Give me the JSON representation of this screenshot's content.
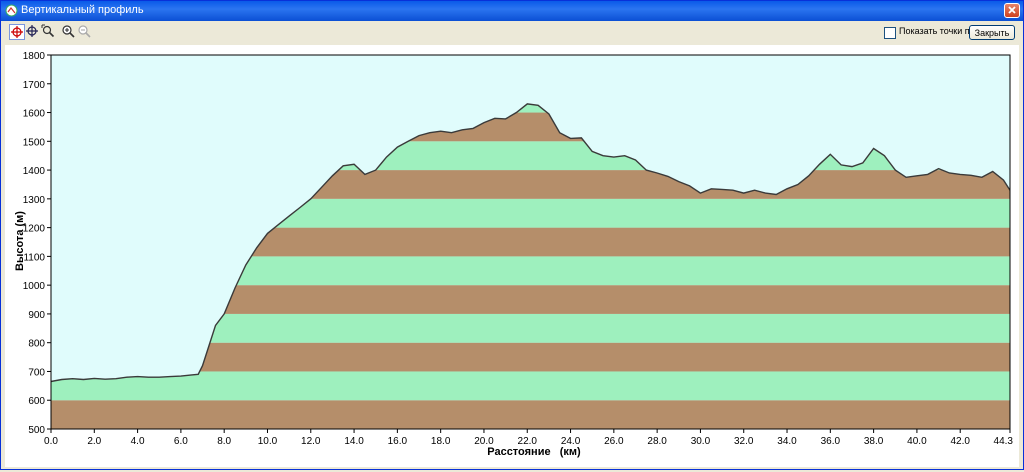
{
  "window": {
    "title": "Вертикальный профиль"
  },
  "toolbar": {
    "tools": [
      {
        "name": "select-point-tool",
        "icon": "crosshair-red-icon",
        "active": true
      },
      {
        "name": "move-tool",
        "icon": "crosshair-blue-icon",
        "active": false
      },
      {
        "name": "zoom-area-tool",
        "icon": "zoom-area-icon",
        "active": false
      },
      {
        "name": "zoom-in-tool",
        "icon": "zoom-in-icon",
        "active": false
      },
      {
        "name": "zoom-out-tool",
        "icon": "zoom-out-icon",
        "active": false
      }
    ],
    "show_waypoints_label": "Показать точки пути",
    "show_waypoints_checked": false,
    "close_label": "Закрыть"
  },
  "colors": {
    "plot_background": "#e0fcfc",
    "band_green": "#9ef0be",
    "band_brown": "#b58e6a",
    "profile_line": "#3a3a3a"
  },
  "chart_data": {
    "type": "area",
    "xlabel": "Расстояние   (км)",
    "ylabel": "Высота (м)",
    "xlim": [
      0,
      44.3
    ],
    "ylim": [
      500,
      1800
    ],
    "x_ticks": [
      "0.0",
      "2.0",
      "4.0",
      "6.0",
      "8.0",
      "10.0",
      "12.0",
      "14.0",
      "16.0",
      "18.0",
      "20.0",
      "22.0",
      "24.0",
      "26.0",
      "28.0",
      "30.0",
      "32.0",
      "34.0",
      "36.0",
      "38.0",
      "40.0",
      "42.0",
      "44.3"
    ],
    "y_ticks": [
      "500",
      "600",
      "700",
      "800",
      "900",
      "1000",
      "1100",
      "1200",
      "1300",
      "1400",
      "1500",
      "1600",
      "1700",
      "1800"
    ],
    "grid": false,
    "series": [
      {
        "x": [
          0,
          0.5,
          1,
          1.5,
          2,
          2.5,
          3,
          3.5,
          4,
          4.5,
          5,
          5.5,
          6,
          6.5,
          6.8,
          7,
          7.3,
          7.6,
          8,
          8.5,
          9,
          9.5,
          10,
          10.5,
          11,
          11.5,
          12,
          12.5,
          13,
          13.5,
          14,
          14.5,
          15,
          15.5,
          16,
          16.5,
          17,
          17.5,
          18,
          18.5,
          19,
          19.5,
          20,
          20.5,
          21,
          21.5,
          22,
          22.5,
          23,
          23.5,
          24,
          24.5,
          25,
          25.5,
          26,
          26.5,
          27,
          27.5,
          28,
          28.5,
          29,
          29.5,
          30,
          30.5,
          31,
          31.5,
          32,
          32.5,
          33,
          33.5,
          34,
          34.5,
          35,
          35.5,
          36,
          36.5,
          37,
          37.5,
          38,
          38.5,
          39,
          39.5,
          40,
          40.5,
          41,
          41.5,
          42,
          42.5,
          43,
          43.5,
          44,
          44.3
        ],
        "y": [
          665,
          672,
          675,
          672,
          676,
          673,
          675,
          680,
          682,
          680,
          680,
          682,
          684,
          688,
          690,
          720,
          790,
          860,
          900,
          990,
          1070,
          1130,
          1180,
          1210,
          1240,
          1270,
          1300,
          1340,
          1380,
          1415,
          1420,
          1385,
          1400,
          1445,
          1480,
          1500,
          1520,
          1530,
          1535,
          1530,
          1540,
          1545,
          1565,
          1580,
          1578,
          1600,
          1630,
          1625,
          1595,
          1530,
          1510,
          1512,
          1465,
          1450,
          1445,
          1450,
          1435,
          1400,
          1390,
          1378,
          1360,
          1345,
          1320,
          1335,
          1333,
          1330,
          1320,
          1330,
          1320,
          1315,
          1335,
          1350,
          1380,
          1420,
          1455,
          1418,
          1412,
          1425,
          1475,
          1450,
          1400,
          1375,
          1380,
          1385,
          1405,
          1390,
          1385,
          1382,
          1375,
          1395,
          1365,
          1330
        ]
      }
    ]
  }
}
